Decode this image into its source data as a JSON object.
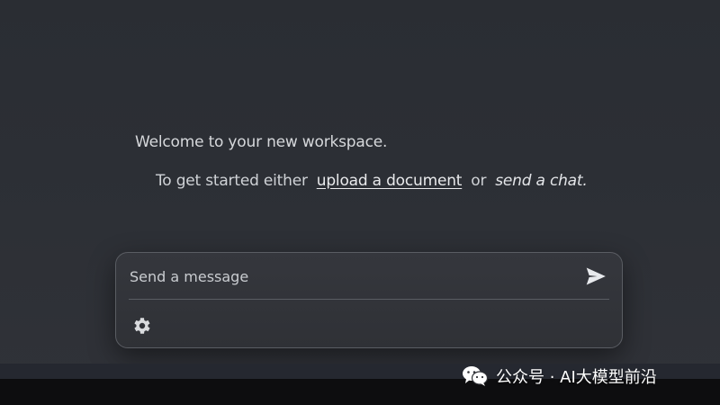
{
  "welcome": {
    "title": "Welcome to your new workspace.",
    "prefix": "To get started either",
    "upload_link": "upload a document",
    "or_text": "or",
    "send_chat": "send a chat."
  },
  "composer": {
    "placeholder": "Send a message",
    "send_icon": "send-icon",
    "settings_icon": "gear-icon"
  },
  "watermark": {
    "text": "公众号 · AI大模型前沿",
    "icon": "wechat-icon"
  },
  "colors": {
    "background": "#2b2e34",
    "composer_border": "#5a5d63",
    "text": "#d6d8db",
    "bottom_bar": "#0d0d0f"
  }
}
